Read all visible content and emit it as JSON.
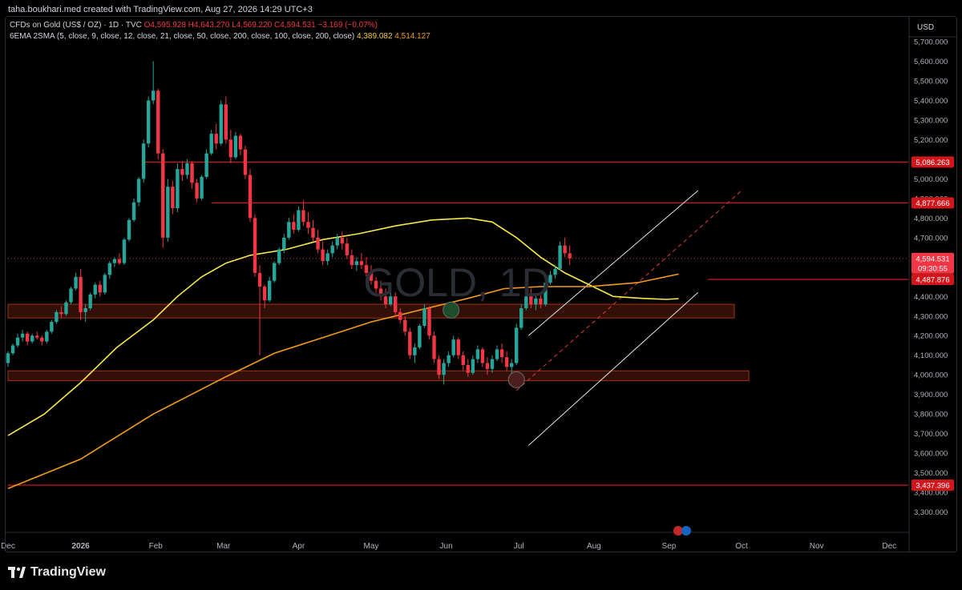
{
  "header": {
    "credit": "taha.boukhari.med created with TradingView.com, Aug 27, 2026 14:29 UTC+3",
    "symbol_line": "CFDs on Gold (US$ / OZ) · 1D · TVC",
    "ohlc": {
      "o": "O4,595.928",
      "h": "H4,643.270",
      "l": "L4,569.220",
      "c": "C4,594.531",
      "chg": "−3.169 (−0.07%)"
    },
    "ma_line": "6EMA 2SMA (5, close, 9, close, 12, close, 21, close, 50, close, 200, close, 100, close, 200, close)",
    "ma_val1": "4,389.082",
    "ma_val2": "4,514.127"
  },
  "watermark": "GOLD, 1D",
  "footer": {
    "brand": "TradingView"
  },
  "colors": {
    "up": "#26a69a",
    "down": "#f23645",
    "ema": "#f7e94b",
    "sma": "#f59c1a",
    "level": "#d1151b",
    "zone": "#5c1e0c"
  },
  "chart_data": {
    "type": "candlestick",
    "currency": "USD",
    "x_labels": [
      "Dec",
      "2026",
      "Feb",
      "Mar",
      "Apr",
      "May",
      "Jun",
      "Jul",
      "Aug",
      "Sep",
      "Oct",
      "Nov",
      "Dec"
    ],
    "x_label_day": [
      0,
      30,
      61,
      89,
      120,
      150,
      181,
      211,
      242,
      273,
      303,
      334,
      364
    ],
    "ylim": [
      3200,
      5800
    ],
    "y_ticks": [
      "3,300.000",
      "3,400.000",
      "3,500.000",
      "3,600.000",
      "3,700.000",
      "3,800.000",
      "3,900.000",
      "4,000.000",
      "4,100.000",
      "4,200.000",
      "4,300.000",
      "4,400.000",
      "4,500.000",
      "4,600.000",
      "4,700.000",
      "4,800.000",
      "4,900.000",
      "5,000.000",
      "5,100.000",
      "5,200.000",
      "5,300.000",
      "5,400.000",
      "5,500.000",
      "5,600.000",
      "5,700.000"
    ],
    "y_tick_values": [
      3300,
      3400,
      3500,
      3600,
      3700,
      3800,
      3900,
      4000,
      4100,
      4200,
      4300,
      4400,
      4500,
      4600,
      4700,
      4800,
      4900,
      5000,
      5100,
      5200,
      5300,
      5400,
      5500,
      5600,
      5700
    ],
    "price_tags": [
      {
        "label": "5,086.263",
        "value": 5086
      },
      {
        "label": "4,877.666",
        "value": 4877
      },
      {
        "label": "4,487.876",
        "value": 4487
      },
      {
        "label": "3,437.396",
        "value": 3437
      }
    ],
    "current_price": {
      "label": "4,594.531",
      "countdown": "09:30:55",
      "value": 4594
    },
    "levels": [
      {
        "value": 5086,
        "from_day": 56
      },
      {
        "value": 4877,
        "from_day": 84
      },
      {
        "value": 4487,
        "from_day": 289
      },
      {
        "value": 3437,
        "from_day": 0
      }
    ],
    "zones": [
      {
        "from_day": 0,
        "to_day": 300,
        "low": 4290,
        "high": 4360
      },
      {
        "from_day": 0,
        "to_day": 306,
        "low": 3970,
        "high": 4020
      }
    ],
    "channel": {
      "upper": [
        [
          215,
          4200
        ],
        [
          285,
          4940
        ]
      ],
      "lower": [
        [
          215,
          3640
        ],
        [
          285,
          4420
        ]
      ],
      "mid": [
        [
          210,
          3920
        ],
        [
          303,
          4940
        ]
      ]
    },
    "markers": [
      {
        "day": 183,
        "value": 4330,
        "color": "#1e4d2b"
      },
      {
        "day": 210,
        "value": 3975,
        "color": "#4d1e1e"
      }
    ],
    "ema_curve": [
      [
        0,
        3690
      ],
      [
        15,
        3800
      ],
      [
        30,
        3960
      ],
      [
        45,
        4140
      ],
      [
        60,
        4280
      ],
      [
        70,
        4400
      ],
      [
        80,
        4500
      ],
      [
        90,
        4570
      ],
      [
        100,
        4610
      ],
      [
        115,
        4640
      ],
      [
        130,
        4690
      ],
      [
        145,
        4720
      ],
      [
        160,
        4760
      ],
      [
        175,
        4790
      ],
      [
        190,
        4800
      ],
      [
        200,
        4780
      ],
      [
        210,
        4700
      ],
      [
        220,
        4600
      ],
      [
        230,
        4520
      ],
      [
        240,
        4460
      ],
      [
        250,
        4400
      ],
      [
        262,
        4390
      ],
      [
        272,
        4385
      ],
      [
        277,
        4389
      ]
    ],
    "sma_curve": [
      [
        0,
        3420
      ],
      [
        30,
        3570
      ],
      [
        60,
        3800
      ],
      [
        90,
        3990
      ],
      [
        110,
        4110
      ],
      [
        130,
        4190
      ],
      [
        150,
        4270
      ],
      [
        170,
        4330
      ],
      [
        190,
        4390
      ],
      [
        205,
        4440
      ],
      [
        220,
        4450
      ],
      [
        240,
        4450
      ],
      [
        260,
        4470
      ],
      [
        277,
        4514
      ]
    ],
    "candles": [
      [
        0,
        4060,
        4120,
        4040,
        4110
      ],
      [
        2,
        4110,
        4160,
        4100,
        4150
      ],
      [
        4,
        4150,
        4210,
        4140,
        4190
      ],
      [
        6,
        4190,
        4230,
        4170,
        4210
      ],
      [
        8,
        4210,
        4220,
        4150,
        4170
      ],
      [
        10,
        4170,
        4210,
        4160,
        4200
      ],
      [
        12,
        4200,
        4220,
        4180,
        4190
      ],
      [
        14,
        4190,
        4200,
        4150,
        4170
      ],
      [
        16,
        4170,
        4230,
        4160,
        4220
      ],
      [
        18,
        4220,
        4280,
        4210,
        4270
      ],
      [
        20,
        4270,
        4330,
        4260,
        4320
      ],
      [
        22,
        4320,
        4350,
        4290,
        4310
      ],
      [
        24,
        4310,
        4380,
        4300,
        4370
      ],
      [
        26,
        4370,
        4450,
        4360,
        4440
      ],
      [
        28,
        4440,
        4520,
        4430,
        4500
      ],
      [
        30,
        4500,
        4540,
        4280,
        4320
      ],
      [
        32,
        4320,
        4360,
        4270,
        4340
      ],
      [
        34,
        4340,
        4420,
        4330,
        4410
      ],
      [
        36,
        4410,
        4470,
        4390,
        4460
      ],
      [
        38,
        4460,
        4480,
        4400,
        4420
      ],
      [
        40,
        4420,
        4520,
        4410,
        4510
      ],
      [
        42,
        4510,
        4580,
        4490,
        4570
      ],
      [
        44,
        4570,
        4600,
        4550,
        4590
      ],
      [
        46,
        4590,
        4620,
        4560,
        4570
      ],
      [
        48,
        4570,
        4700,
        4560,
        4690
      ],
      [
        50,
        4690,
        4800,
        4680,
        4790
      ],
      [
        52,
        4790,
        4900,
        4780,
        4880
      ],
      [
        54,
        4880,
        5010,
        4860,
        5000
      ],
      [
        56,
        5000,
        5200,
        4980,
        5180
      ],
      [
        58,
        5180,
        5420,
        5160,
        5400
      ],
      [
        60,
        5400,
        5600,
        5380,
        5450
      ],
      [
        62,
        5450,
        5460,
        5100,
        5130
      ],
      [
        64,
        5130,
        5150,
        4650,
        4700
      ],
      [
        66,
        4700,
        5000,
        4680,
        4960
      ],
      [
        68,
        4960,
        4990,
        4820,
        4850
      ],
      [
        70,
        4850,
        5080,
        4830,
        5050
      ],
      [
        72,
        5050,
        5090,
        4990,
        5020
      ],
      [
        74,
        5020,
        5100,
        5000,
        5080
      ],
      [
        76,
        5080,
        5090,
        4950,
        4980
      ],
      [
        78,
        4980,
        5000,
        4880,
        4900
      ],
      [
        80,
        4900,
        5020,
        4890,
        5010
      ],
      [
        82,
        5010,
        5150,
        5000,
        5130
      ],
      [
        84,
        5130,
        5250,
        5120,
        5230
      ],
      [
        86,
        5230,
        5280,
        5150,
        5180
      ],
      [
        88,
        5180,
        5400,
        5170,
        5380
      ],
      [
        90,
        5380,
        5420,
        5180,
        5200
      ],
      [
        92,
        5200,
        5250,
        5080,
        5110
      ],
      [
        94,
        5110,
        5240,
        5100,
        5220
      ],
      [
        96,
        5220,
        5230,
        5120,
        5150
      ],
      [
        98,
        5150,
        5170,
        5000,
        5020
      ],
      [
        100,
        5020,
        5050,
        4780,
        4800
      ],
      [
        102,
        4800,
        4820,
        4500,
        4520
      ],
      [
        104,
        4520,
        4560,
        4100,
        4450
      ],
      [
        106,
        4450,
        4460,
        4340,
        4380
      ],
      [
        108,
        4380,
        4500,
        4370,
        4480
      ],
      [
        110,
        4480,
        4580,
        4470,
        4570
      ],
      [
        112,
        4570,
        4650,
        4560,
        4640
      ],
      [
        114,
        4640,
        4720,
        4620,
        4700
      ],
      [
        116,
        4700,
        4800,
        4690,
        4780
      ],
      [
        118,
        4780,
        4820,
        4720,
        4740
      ],
      [
        120,
        4740,
        4860,
        4730,
        4840
      ],
      [
        122,
        4840,
        4890,
        4760,
        4780
      ],
      [
        124,
        4780,
        4830,
        4720,
        4750
      ],
      [
        126,
        4750,
        4790,
        4680,
        4700
      ],
      [
        128,
        4700,
        4740,
        4620,
        4640
      ],
      [
        130,
        4640,
        4680,
        4560,
        4580
      ],
      [
        132,
        4580,
        4640,
        4560,
        4620
      ],
      [
        134,
        4620,
        4680,
        4600,
        4660
      ],
      [
        136,
        4660,
        4720,
        4640,
        4700
      ],
      [
        138,
        4700,
        4730,
        4640,
        4670
      ],
      [
        140,
        4670,
        4700,
        4590,
        4610
      ],
      [
        142,
        4610,
        4640,
        4540,
        4560
      ],
      [
        144,
        4560,
        4600,
        4530,
        4580
      ],
      [
        146,
        4580,
        4620,
        4540,
        4560
      ],
      [
        148,
        4560,
        4600,
        4500,
        4520
      ],
      [
        150,
        4520,
        4560,
        4460,
        4480
      ],
      [
        152,
        4480,
        4500,
        4420,
        4440
      ],
      [
        154,
        4440,
        4480,
        4380,
        4400
      ],
      [
        156,
        4400,
        4440,
        4340,
        4360
      ],
      [
        158,
        4360,
        4420,
        4350,
        4400
      ],
      [
        160,
        4400,
        4420,
        4300,
        4320
      ],
      [
        162,
        4320,
        4340,
        4260,
        4280
      ],
      [
        164,
        4280,
        4300,
        4200,
        4220
      ],
      [
        166,
        4220,
        4240,
        4080,
        4100
      ],
      [
        168,
        4100,
        4160,
        4060,
        4140
      ],
      [
        170,
        4140,
        4260,
        4130,
        4250
      ],
      [
        172,
        4250,
        4360,
        4240,
        4340
      ],
      [
        174,
        4340,
        4350,
        4180,
        4200
      ],
      [
        176,
        4200,
        4220,
        4060,
        4080
      ],
      [
        178,
        4080,
        4100,
        3980,
        4000
      ],
      [
        180,
        4000,
        4080,
        3950,
        4060
      ],
      [
        182,
        4060,
        4120,
        4040,
        4100
      ],
      [
        184,
        4100,
        4200,
        4090,
        4180
      ],
      [
        186,
        4180,
        4190,
        4080,
        4100
      ],
      [
        188,
        4100,
        4120,
        4020,
        4050
      ],
      [
        190,
        4050,
        4080,
        3990,
        4010
      ],
      [
        192,
        4010,
        4100,
        4000,
        4080
      ],
      [
        194,
        4080,
        4150,
        4060,
        4130
      ],
      [
        196,
        4130,
        4140,
        4040,
        4060
      ],
      [
        198,
        4060,
        4090,
        4000,
        4030
      ],
      [
        200,
        4030,
        4100,
        4010,
        4080
      ],
      [
        202,
        4080,
        4150,
        4070,
        4130
      ],
      [
        204,
        4130,
        4160,
        4060,
        4090
      ],
      [
        206,
        4090,
        4120,
        4020,
        4040
      ],
      [
        208,
        4040,
        4080,
        4000,
        4060
      ],
      [
        210,
        4060,
        4260,
        4050,
        4240
      ],
      [
        212,
        4240,
        4360,
        4230,
        4340
      ],
      [
        214,
        4340,
        4420,
        4330,
        4400
      ],
      [
        216,
        4400,
        4440,
        4340,
        4360
      ],
      [
        218,
        4360,
        4410,
        4330,
        4390
      ],
      [
        220,
        4390,
        4420,
        4340,
        4360
      ],
      [
        222,
        4360,
        4480,
        4350,
        4470
      ],
      [
        224,
        4470,
        4530,
        4460,
        4510
      ],
      [
        226,
        4510,
        4560,
        4490,
        4540
      ],
      [
        228,
        4540,
        4680,
        4530,
        4660
      ],
      [
        230,
        4660,
        4700,
        4600,
        4620
      ],
      [
        232,
        4620,
        4660,
        4560,
        4594
      ]
    ]
  }
}
